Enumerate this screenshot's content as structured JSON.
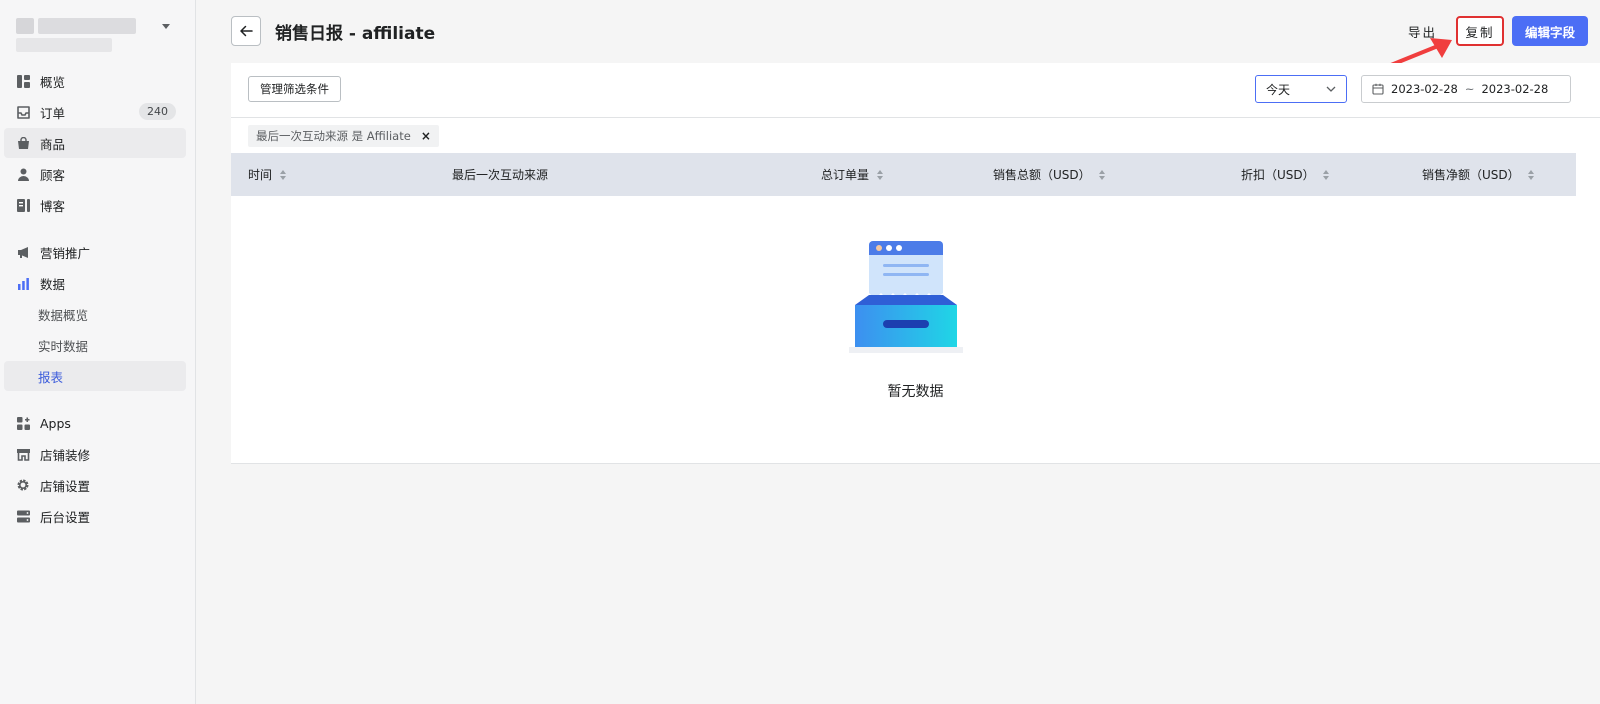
{
  "sidebar": {
    "items": [
      {
        "label": "概览",
        "icon": "dashboard-icon"
      },
      {
        "label": "订单",
        "icon": "inbox-icon",
        "badge": "240"
      },
      {
        "label": "商品",
        "icon": "bag-icon"
      },
      {
        "label": "顾客",
        "icon": "person-icon"
      },
      {
        "label": "博客",
        "icon": "blog-icon"
      },
      {
        "label": "营销推广",
        "icon": "megaphone-icon"
      },
      {
        "label": "数据",
        "icon": "bar-chart-icon"
      },
      {
        "label": "数据概览"
      },
      {
        "label": "实时数据"
      },
      {
        "label": "报表"
      },
      {
        "label": "Apps",
        "icon": "apps-icon"
      },
      {
        "label": "店铺装修",
        "icon": "store-icon"
      },
      {
        "label": "店铺设置",
        "icon": "gear-icon"
      },
      {
        "label": "后台设置",
        "icon": "server-icon"
      }
    ]
  },
  "header": {
    "title": "销售日报 - affiliate",
    "export_label": "导出",
    "copy_label": "复制",
    "edit_label": "编辑字段"
  },
  "filters": {
    "manage_label": "管理筛选条件",
    "range_value": "今天",
    "date_start": "2023-02-28",
    "date_sep": "~",
    "date_end": "2023-02-28",
    "tag_label": "最后一次互动来源 是 Affiliate",
    "tag_close": "×"
  },
  "table": {
    "columns": [
      "时间",
      "最后一次互动来源",
      "总订单量",
      "销售总额（USD）",
      "折扣（USD）",
      "销售净额（USD）"
    ]
  },
  "empty": {
    "text": "暂无数据"
  },
  "colors": {
    "accent": "#4c6ef5",
    "highlight": "#e03131",
    "header_bg": "#dfe3eb"
  }
}
